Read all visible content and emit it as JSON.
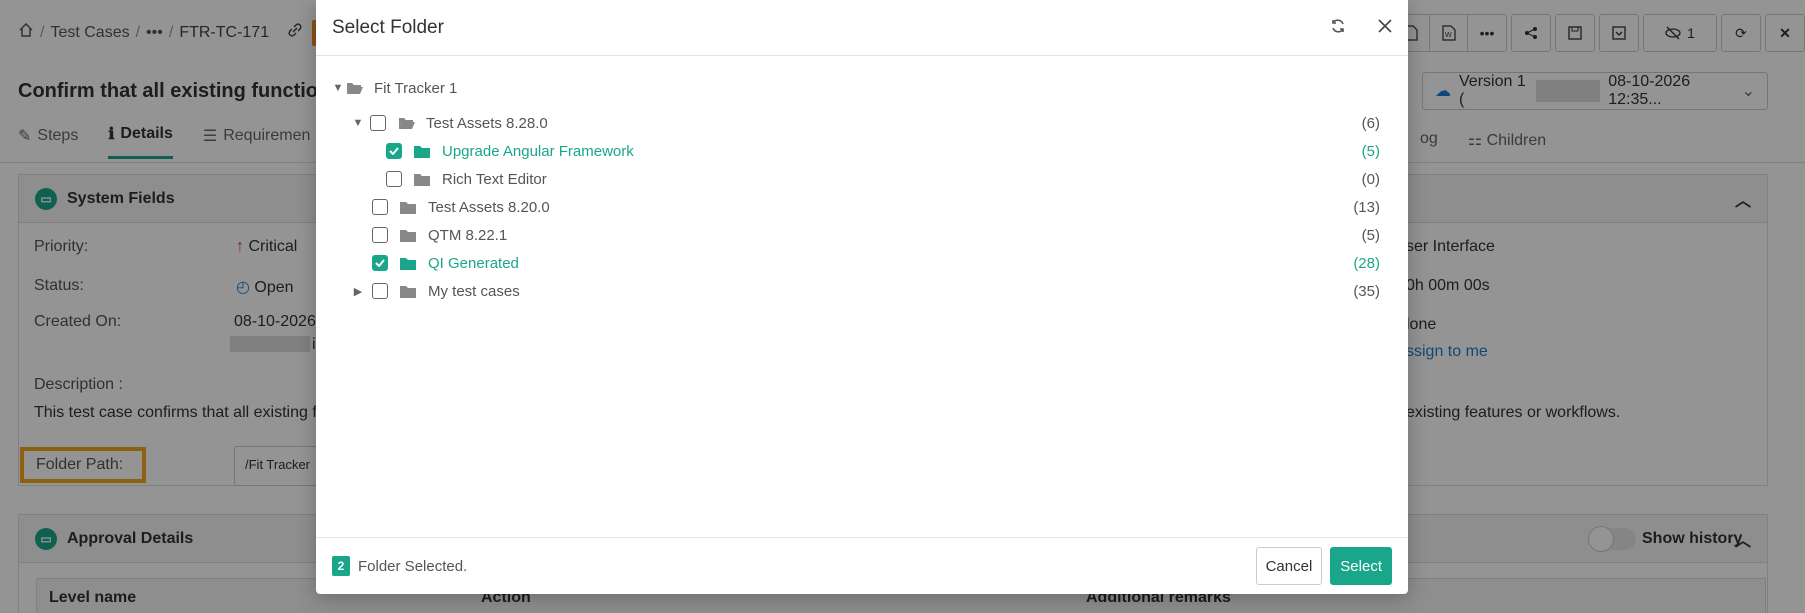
{
  "breadcrumb": {
    "home_icon": "home-icon",
    "section": "Test Cases",
    "more": "•••",
    "id": "FTR-TC-171",
    "link_icon": "link-icon"
  },
  "page": {
    "title": "Confirm that all existing functiona"
  },
  "version": {
    "label": "Version 1 (",
    "date": "08-10-2026 12:35..."
  },
  "toolbar": {
    "hidden_count": "1"
  },
  "tabs": {
    "steps": "Steps",
    "details": "Details",
    "requirements": "Requiremen",
    "log": "og",
    "children": "Children"
  },
  "system_fields": {
    "title": "System Fields",
    "priority_label": "Priority:",
    "priority_value": "Critical",
    "status_label": "Status:",
    "status_value": "Open",
    "created_label": "Created On:",
    "created_value": "08-10-2026",
    "created_suffix": "i",
    "description_label": "Description :",
    "description_value": "This test case confirms that all existing fu",
    "description_tail": "existing features or workflows.",
    "folder_path_label": "Folder Path:",
    "folder_path_value": "/Fit Tracker",
    "right_component": "ser Interface",
    "right_estimate": "0h 00m 00s",
    "right_assignee": "lone",
    "assign_me": "ssign to me"
  },
  "approval": {
    "title": "Approval Details",
    "show_history": "Show history",
    "col_level": "Level name",
    "col_action": "Action",
    "col_remarks": "Additional remarks"
  },
  "modal": {
    "title": "Select Folder",
    "root": "Fit Tracker 1",
    "items": [
      {
        "label": "Test Assets 8.28.0",
        "count": "(6)"
      },
      {
        "label": "Upgrade Angular Framework",
        "count": "(5)"
      },
      {
        "label": "Rich Text Editor",
        "count": "(0)"
      },
      {
        "label": "Test Assets 8.20.0",
        "count": "(13)"
      },
      {
        "label": "QTM 8.22.1",
        "count": "(5)"
      },
      {
        "label": "QI Generated",
        "count": "(28)"
      },
      {
        "label": "My test cases",
        "count": "(35)"
      }
    ],
    "selected_count": "2",
    "selected_text": "Folder Selected.",
    "cancel": "Cancel",
    "select": "Select"
  },
  "colors": {
    "accent": "#1aa68a",
    "highlight": "#f2a81d"
  }
}
